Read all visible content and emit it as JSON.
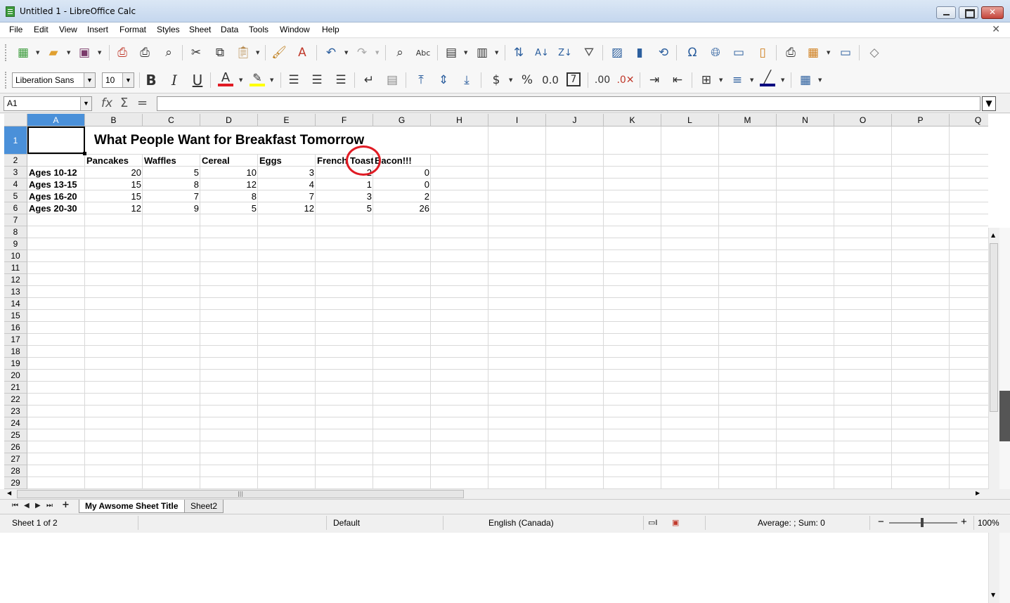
{
  "window": {
    "title": "Untitled 1 - LibreOffice Calc"
  },
  "menu": [
    "File",
    "Edit",
    "View",
    "Insert",
    "Format",
    "Styles",
    "Sheet",
    "Data",
    "Tools",
    "Window",
    "Help"
  ],
  "formatting": {
    "font_name": "Liberation Sans",
    "font_size": "10"
  },
  "formula_bar": {
    "cell_ref": "A1",
    "formula": ""
  },
  "columns": [
    "A",
    "B",
    "C",
    "D",
    "E",
    "F",
    "G",
    "H",
    "I",
    "J",
    "K",
    "L",
    "M",
    "N",
    "O",
    "P",
    "Q"
  ],
  "rows": [
    "1",
    "2",
    "3",
    "4",
    "5",
    "6",
    "7",
    "8",
    "9",
    "10",
    "11",
    "12",
    "13",
    "14",
    "15",
    "16",
    "17",
    "18",
    "19",
    "20",
    "21",
    "22",
    "23",
    "24",
    "25",
    "26",
    "27",
    "28",
    "29"
  ],
  "sheet": {
    "title": "What People Want for Breakfast Tomorrow",
    "headers": [
      "Pancakes",
      "Waffles",
      "Cereal",
      "Eggs",
      "French Toast",
      "Bacon!!!"
    ],
    "data": [
      {
        "label": "Ages 10-12",
        "values": [
          "20",
          "5",
          "10",
          "3",
          "2",
          "0"
        ]
      },
      {
        "label": "Ages 13-15",
        "values": [
          "15",
          "8",
          "12",
          "4",
          "1",
          "0"
        ]
      },
      {
        "label": "Ages 16-20",
        "values": [
          "15",
          "7",
          "8",
          "7",
          "3",
          "2"
        ]
      },
      {
        "label": "Ages 20-30",
        "values": [
          "12",
          "9",
          "5",
          "12",
          "5",
          "26"
        ]
      }
    ]
  },
  "tabs": [
    "My Awsome Sheet Title",
    "Sheet2"
  ],
  "status": {
    "sheet_info": "Sheet 1 of 2",
    "page_style": "Default",
    "language": "English (Canada)",
    "summary": "Average: ; Sum: 0",
    "zoom": "100%"
  },
  "colors": {
    "selection": "#4a90d9",
    "annotation": "#e01b24",
    "font_color": "#e01b24",
    "highlight": "#ffff00"
  }
}
